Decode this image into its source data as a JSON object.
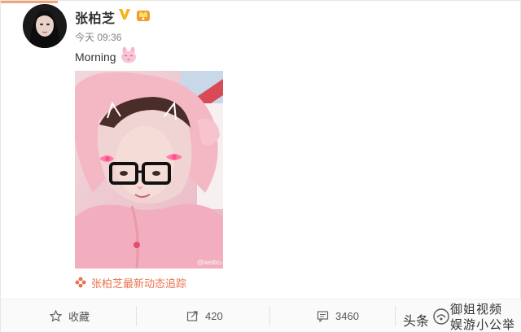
{
  "post": {
    "username": "张柏芝",
    "timestamp": "今天 09:36",
    "text": "Morning",
    "photo_watermark": "@weibo.com",
    "tracking_link": "张柏芝最新动态追踪"
  },
  "actions": {
    "favorite_label": "收藏",
    "repost_count": "420",
    "comment_count": "3460"
  },
  "watermark": {
    "source": "头条",
    "account_line1": "御姐视频",
    "account_line2": "娱游小公举"
  },
  "colors": {
    "accent_orange": "#eb7350",
    "verified_gold": "#f6b41a",
    "pink_hood": "#f2b3c0"
  },
  "icons": {
    "verified": "verified-v-icon",
    "vip": "vip-crown-icon",
    "emoji": "pink-bunny-emoji-icon",
    "tracking": "flower-icon",
    "favorite": "star-icon",
    "repost": "share-arrow-icon",
    "comment": "comment-bubble-icon"
  }
}
